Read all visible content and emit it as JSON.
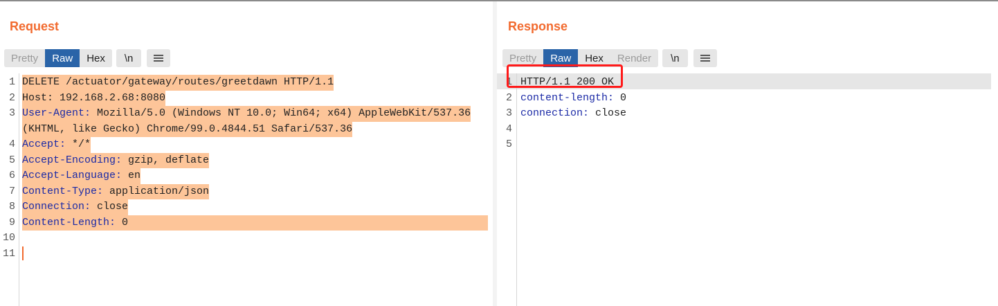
{
  "request": {
    "title": "Request",
    "tabs": [
      "Pretty",
      "Raw",
      "Hex"
    ],
    "active_tab": "Raw",
    "newline_label": "\\n",
    "lines": [
      {
        "num": "1",
        "key": "DELETE /actuator/gateway/routes/greetdawn HTTP/1.1",
        "val": ""
      },
      {
        "num": "2",
        "key": "Host: 192.168.2.68:8080",
        "val": ""
      },
      {
        "num": "3",
        "key": "User-Agent:",
        "val": " Mozilla/5.0 (Windows NT 10.0; Win64; x64) AppleWebKit/537.36"
      },
      {
        "num": "",
        "key": "",
        "val": "(KHTML, like Gecko) Chrome/99.0.4844.51 Safari/537.36"
      },
      {
        "num": "4",
        "key": "Accept:",
        "val": " */*"
      },
      {
        "num": "5",
        "key": "Accept-Encoding:",
        "val": " gzip, deflate"
      },
      {
        "num": "6",
        "key": "Accept-Language:",
        "val": " en"
      },
      {
        "num": "7",
        "key": "Content-Type:",
        "val": " application/json"
      },
      {
        "num": "8",
        "key": "Connection:",
        "val": " close"
      },
      {
        "num": "9",
        "key": "Content-Length:",
        "val": " 0"
      },
      {
        "num": "10",
        "key": "",
        "val": ""
      },
      {
        "num": "11",
        "key": "",
        "val": ""
      }
    ]
  },
  "response": {
    "title": "Response",
    "tabs": [
      "Pretty",
      "Raw",
      "Hex",
      "Render"
    ],
    "active_tab": "Raw",
    "newline_label": "\\n",
    "lines": [
      {
        "num": "1",
        "key": "",
        "val": "HTTP/1.1 200 OK"
      },
      {
        "num": "2",
        "key": "content-length:",
        "val": " 0"
      },
      {
        "num": "3",
        "key": "connection:",
        "val": " close"
      },
      {
        "num": "4",
        "key": "",
        "val": ""
      },
      {
        "num": "5",
        "key": "",
        "val": ""
      }
    ]
  },
  "layout_controls": [
    "side-by-side",
    "horizontal-split",
    "single-pane"
  ],
  "colors": {
    "accent_title": "#f26a2e",
    "active_tab": "#2a64a8",
    "highlight": "#fdc599",
    "header_key": "#1b2aa6",
    "annotation_box": "#ff1a1a"
  }
}
